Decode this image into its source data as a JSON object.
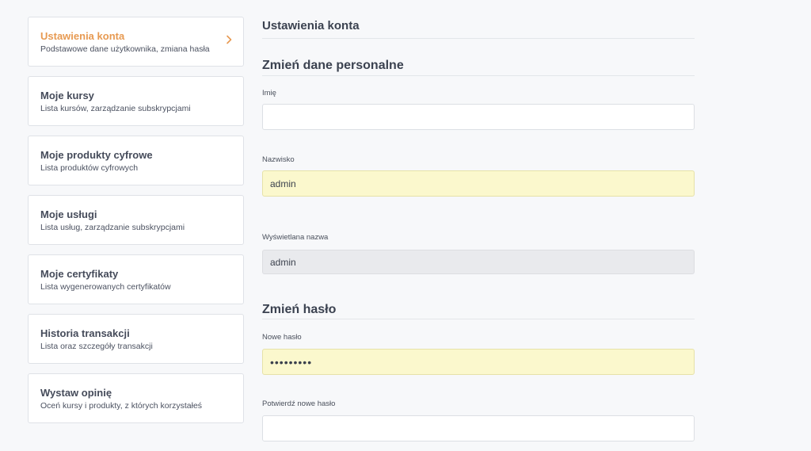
{
  "sidebar": {
    "items": [
      {
        "title": "Ustawienia konta",
        "subtitle": "Podstawowe dane użytkownika, zmiana hasła",
        "active": true
      },
      {
        "title": "Moje kursy",
        "subtitle": "Lista kursów, zarządzanie subskrypcjami",
        "active": false
      },
      {
        "title": "Moje produkty cyfrowe",
        "subtitle": "Lista produktów cyfrowych",
        "active": false
      },
      {
        "title": "Moje usługi",
        "subtitle": "Lista usług, zarządzanie subskrypcjami",
        "active": false
      },
      {
        "title": "Moje certyfikaty",
        "subtitle": "Lista wygenerowanych certyfikatów",
        "active": false
      },
      {
        "title": "Historia transakcji",
        "subtitle": "Lista oraz szczegóły transakcji",
        "active": false
      },
      {
        "title": "Wystaw opinię",
        "subtitle": "Oceń kursy i produkty, z których korzystałeś",
        "active": false
      }
    ],
    "active_icon": "chevron-right-icon"
  },
  "main": {
    "title": "Ustawienia konta",
    "personal": {
      "heading": "Zmień dane personalne",
      "first_name": {
        "label": "Imię",
        "value": ""
      },
      "last_name": {
        "label": "Nazwisko",
        "value": "admin"
      },
      "display_name": {
        "label": "Wyświetlana nazwa",
        "value": "admin"
      }
    },
    "password": {
      "heading": "Zmień hasło",
      "new_password": {
        "label": "Nowe hasło",
        "value": "•••••••••"
      },
      "confirm_password": {
        "label": "Potwierdź nowe hasło",
        "value": ""
      }
    }
  },
  "colors": {
    "active_accent": "#e79a52",
    "autofill_background": "#fbf8cd",
    "readonly_background": "#e9eaed",
    "page_background": "#f7f8fa"
  }
}
